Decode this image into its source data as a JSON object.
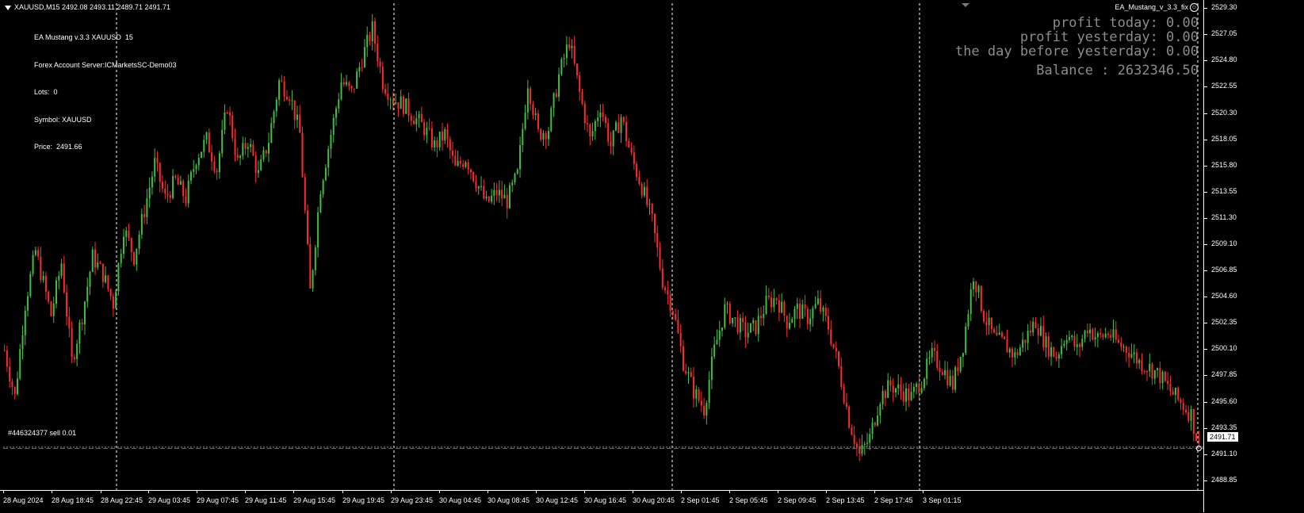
{
  "header": {
    "symbol_line": "XAUUSD,M15  2492.08 2493.11 2489.71 2491.71",
    "info_lines": [
      "EA Mustang v.3.3 XAUUSD  15",
      "Forex Account Server:ICMarketsSC-Demo03",
      "Lots:  0",
      "Symbol: XAUUSD",
      "Price:  2491.66"
    ],
    "ea_name": "EA_Mustang_v_3.3_fix",
    "smile_glyph": "☺"
  },
  "stats": {
    "profit_today": "profit today: 0.00",
    "profit_yesterday": "profit yesterday: 0.00",
    "profit_day_before": "the day before yesterday: 0.00",
    "balance": "Balance : 2632346.50"
  },
  "order": {
    "label": "#446324377 sell 0.01",
    "current_price": "2491.71"
  },
  "colors": {
    "bull": "#3fbf3f",
    "bear": "#ff2a2a",
    "order_line": "#ff2a2a",
    "current_line": "#8a8a8a",
    "grid": "#ffffff"
  },
  "chart_data": {
    "type": "candlestick",
    "symbol": "XAUUSD",
    "timeframe": "M15",
    "ylim": [
      2488.85,
      2529.3
    ],
    "price_ticks": [
      "2529.30",
      "2527.05",
      "2524.80",
      "2522.55",
      "2520.30",
      "2518.05",
      "2515.80",
      "2513.55",
      "2511.30",
      "2509.10",
      "2506.85",
      "2504.60",
      "2502.35",
      "2500.10",
      "2497.85",
      "2495.60",
      "2493.35",
      "2491.10",
      "2488.85"
    ],
    "time_labels": [
      "28 Aug 2024",
      "28 Aug 18:45",
      "28 Aug 22:45",
      "29 Aug 03:45",
      "29 Aug 07:45",
      "29 Aug 11:45",
      "29 Aug 15:45",
      "29 Aug 19:45",
      "29 Aug 23:45",
      "30 Aug 04:45",
      "30 Aug 08:45",
      "30 Aug 12:45",
      "30 Aug 16:45",
      "30 Aug 20:45",
      "2 Sep 01:45",
      "2 Sep 05:45",
      "2 Sep 09:45",
      "2 Sep 13:45",
      "2 Sep 17:45",
      "3 Sep 01:15"
    ],
    "day_separators": [
      "28 Aug 22:45",
      "29 Aug 23:45",
      "30 Aug 20:45",
      "2 Sep 22:45",
      "3 Sep 02:45"
    ],
    "order_price": 2491.6,
    "current_price": 2491.71,
    "close_path": [
      [
        0,
        2500.0
      ],
      [
        4,
        2496.0
      ],
      [
        8,
        2504.0
      ],
      [
        12,
        2508.5
      ],
      [
        18,
        2503.0
      ],
      [
        22,
        2507.5
      ],
      [
        26,
        2499.0
      ],
      [
        30,
        2503.0
      ],
      [
        34,
        2508.0
      ],
      [
        38,
        2506.5
      ],
      [
        42,
        2504.0
      ],
      [
        46,
        2510.5
      ],
      [
        50,
        2508.0
      ],
      [
        54,
        2512.0
      ],
      [
        58,
        2516.0
      ],
      [
        62,
        2513.0
      ],
      [
        66,
        2514.5
      ],
      [
        70,
        2513.0
      ],
      [
        74,
        2516.5
      ],
      [
        78,
        2518.0
      ],
      [
        82,
        2515.5
      ],
      [
        86,
        2521.0
      ],
      [
        90,
        2516.0
      ],
      [
        94,
        2518.0
      ],
      [
        98,
        2515.0
      ],
      [
        102,
        2518.0
      ],
      [
        106,
        2523.0
      ],
      [
        110,
        2522.0
      ],
      [
        114,
        2518.5
      ],
      [
        118,
        2505.0
      ],
      [
        122,
        2514.0
      ],
      [
        126,
        2518.5
      ],
      [
        130,
        2523.0
      ],
      [
        134,
        2522.0
      ],
      [
        138,
        2525.0
      ],
      [
        142,
        2527.5
      ],
      [
        146,
        2523.0
      ],
      [
        150,
        2521.5
      ],
      [
        154,
        2521.0
      ],
      [
        158,
        2520.0
      ],
      [
        162,
        2519.0
      ],
      [
        166,
        2517.5
      ],
      [
        170,
        2518.5
      ],
      [
        174,
        2515.5
      ],
      [
        178,
        2516.5
      ],
      [
        182,
        2514.5
      ],
      [
        186,
        2512.5
      ],
      [
        190,
        2513.5
      ],
      [
        194,
        2512.8
      ],
      [
        198,
        2515.0
      ],
      [
        202,
        2523.0
      ],
      [
        206,
        2518.5
      ],
      [
        210,
        2519.0
      ],
      [
        214,
        2523.5
      ],
      [
        218,
        2526.5
      ],
      [
        222,
        2522.0
      ],
      [
        226,
        2518.0
      ],
      [
        230,
        2521.0
      ],
      [
        234,
        2517.5
      ],
      [
        238,
        2520.0
      ],
      [
        242,
        2516.5
      ],
      [
        246,
        2514.0
      ],
      [
        250,
        2511.0
      ],
      [
        254,
        2506.0
      ],
      [
        258,
        2503.5
      ],
      [
        262,
        2499.0
      ],
      [
        266,
        2496.5
      ],
      [
        270,
        2495.0
      ],
      [
        274,
        2500.0
      ],
      [
        278,
        2503.5
      ],
      [
        282,
        2502.5
      ],
      [
        286,
        2501.5
      ],
      [
        290,
        2502.0
      ],
      [
        294,
        2504.0
      ],
      [
        298,
        2504.5
      ],
      [
        302,
        2502.5
      ],
      [
        306,
        2503.5
      ],
      [
        310,
        2502.8
      ],
      [
        314,
        2504.0
      ],
      [
        318,
        2502.0
      ],
      [
        322,
        2498.5
      ],
      [
        326,
        2494.0
      ],
      [
        330,
        2491.0
      ],
      [
        334,
        2492.5
      ],
      [
        338,
        2496.0
      ],
      [
        342,
        2497.0
      ],
      [
        346,
        2496.5
      ],
      [
        350,
        2496.0
      ],
      [
        354,
        2497.5
      ],
      [
        358,
        2499.5
      ],
      [
        362,
        2498.5
      ],
      [
        366,
        2497.0
      ],
      [
        370,
        2500.5
      ],
      [
        374,
        2506.5
      ],
      [
        378,
        2503.0
      ],
      [
        382,
        2501.0
      ],
      [
        386,
        2500.5
      ],
      [
        390,
        2499.5
      ],
      [
        394,
        2501.0
      ],
      [
        398,
        2502.5
      ],
      [
        402,
        2500.5
      ],
      [
        406,
        2499.5
      ],
      [
        410,
        2501.5
      ],
      [
        414,
        2500.0
      ],
      [
        418,
        2502.0
      ],
      [
        422,
        2501.0
      ],
      [
        426,
        2501.5
      ],
      [
        430,
        2500.5
      ],
      [
        434,
        2500.0
      ],
      [
        438,
        2499.0
      ],
      [
        442,
        2498.5
      ],
      [
        446,
        2497.8
      ],
      [
        450,
        2496.5
      ],
      [
        454,
        2495.5
      ],
      [
        458,
        2494.5
      ],
      [
        461,
        2491.7
      ]
    ]
  }
}
